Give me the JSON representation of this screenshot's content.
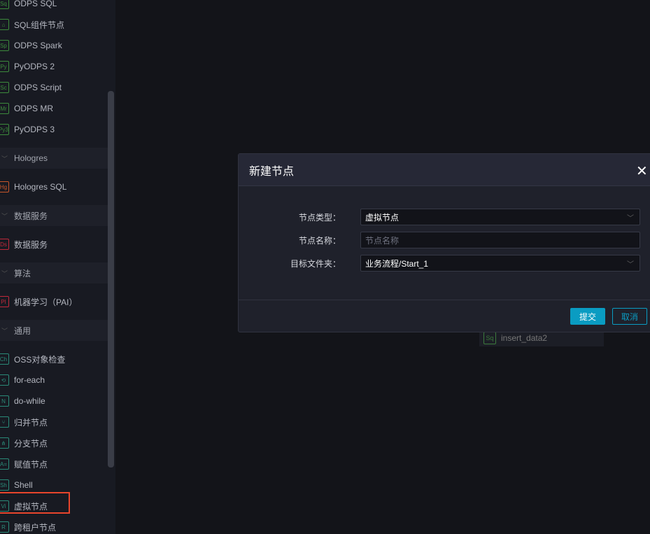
{
  "sidebar": {
    "entries": [
      {
        "type": "item",
        "label": "ODPS SQL",
        "icon": "Sq",
        "color": "#3c8a3c"
      },
      {
        "type": "item",
        "label": "SQL组件节点",
        "icon": "⌂",
        "color": "#3c8a3c"
      },
      {
        "type": "item",
        "label": "ODPS Spark",
        "icon": "Sp",
        "color": "#3c8a3c"
      },
      {
        "type": "item",
        "label": "PyODPS 2",
        "icon": "Py",
        "color": "#3c8a3c"
      },
      {
        "type": "item",
        "label": "ODPS Script",
        "icon": "Sc",
        "color": "#3c8a3c"
      },
      {
        "type": "item",
        "label": "ODPS MR",
        "icon": "Mr",
        "color": "#3c8a3c"
      },
      {
        "type": "item",
        "label": "PyODPS 3",
        "icon": "Py3",
        "color": "#3c8a3c"
      },
      {
        "type": "group",
        "label": "Hologres"
      },
      {
        "type": "item",
        "label": "Hologres SQL",
        "icon": "Hg",
        "color": "#c8562a"
      },
      {
        "type": "group",
        "label": "数据服务"
      },
      {
        "type": "item",
        "label": "数据服务",
        "icon": "Ds",
        "color": "#c0283a"
      },
      {
        "type": "group",
        "label": "算法"
      },
      {
        "type": "item",
        "label": "机器学习（PAI）",
        "icon": "PI",
        "color": "#c0283a"
      },
      {
        "type": "group",
        "label": "通用"
      },
      {
        "type": "item",
        "label": "OSS对象检查",
        "icon": "Ch",
        "color": "#2a8a78"
      },
      {
        "type": "item",
        "label": "for-each",
        "icon": "⟲",
        "color": "#2a8a78"
      },
      {
        "type": "item",
        "label": "do-while",
        "icon": "N",
        "color": "#2a8a78"
      },
      {
        "type": "item",
        "label": "归并节点",
        "icon": "⑂",
        "color": "#2a8a78"
      },
      {
        "type": "item",
        "label": "分支节点",
        "icon": "⋔",
        "color": "#2a8a78"
      },
      {
        "type": "item",
        "label": "赋值节点",
        "icon": "A=",
        "color": "#2a8a78"
      },
      {
        "type": "item",
        "label": "Shell",
        "icon": "Sh",
        "color": "#2a8a78"
      },
      {
        "type": "item",
        "label": "虚拟节点",
        "icon": "Vi",
        "color": "#2a8a78",
        "highlighted": true
      },
      {
        "type": "item",
        "label": "跨租户节点",
        "icon": "R",
        "color": "#2a8a78"
      }
    ]
  },
  "canvas": {
    "node_label": "insert_data2",
    "node_icon": "Sq"
  },
  "dialog": {
    "title": "新建节点",
    "close_icon": "close-icon",
    "fields": {
      "type_label": "节点类型：",
      "type_value": "虚拟节点",
      "name_label": "节点名称：",
      "name_placeholder": "节点名称",
      "name_value": "",
      "folder_label": "目标文件夹：",
      "folder_value": "业务流程/Start_1"
    },
    "submit": "提交",
    "cancel": "取消"
  },
  "colors": {
    "accent": "#0a9cc2",
    "highlight": "#e8452c"
  }
}
